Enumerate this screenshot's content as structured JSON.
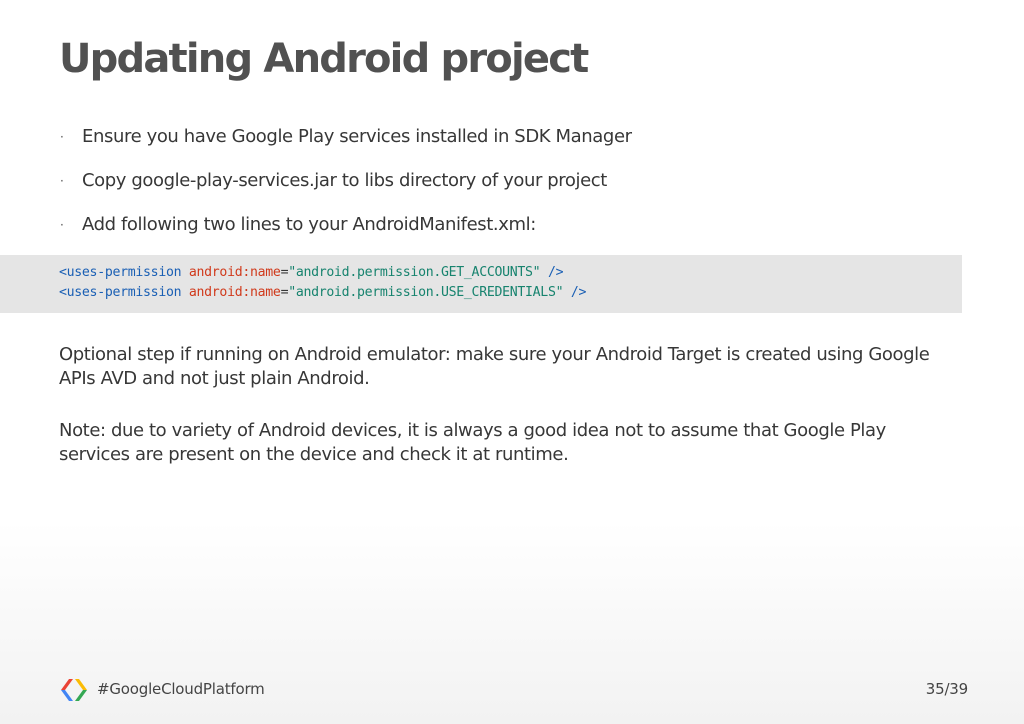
{
  "slide": {
    "title": "Updating Android project",
    "bullets": [
      "Ensure you have Google Play services installed in SDK Manager",
      "Copy google-play-services.jar to libs directory of your project",
      "Add following two lines to your AndroidManifest.xml:"
    ],
    "bullet_marker": "·",
    "code": {
      "lines": [
        {
          "tag": "<uses-permission",
          "attr": "android:name",
          "eq": "=",
          "value": "\"android.permission.GET_ACCOUNTS\"",
          "close": " />"
        },
        {
          "tag": "<uses-permission",
          "attr": "android:name",
          "eq": "=",
          "value": "\"android.permission.USE_CREDENTIALS\"",
          "close": " />"
        }
      ]
    },
    "paragraphs": [
      "Optional step if running on Android emulator: make sure your Android Target is created using Google APIs AVD and not just plain Android.",
      "Note: due to variety of Android devices, it is always a good idea not to assume that Google Play services are present on the device and check it at runtime."
    ],
    "footer": {
      "hashtag": "#GoogleCloudPlatform",
      "logo_icon": "google-cloud-platform-logo-icon",
      "page_number": "35/39"
    }
  },
  "colors": {
    "title": "#515151",
    "body_text": "#373737",
    "code_background": "#e5e5e5",
    "code_tag": "#1a5fb4",
    "code_attr": "#d03a1c",
    "code_string": "#17836e",
    "logo_blue": "#4285f4",
    "logo_red": "#ea4335",
    "logo_yellow": "#fbbc05",
    "logo_green": "#34a853"
  }
}
